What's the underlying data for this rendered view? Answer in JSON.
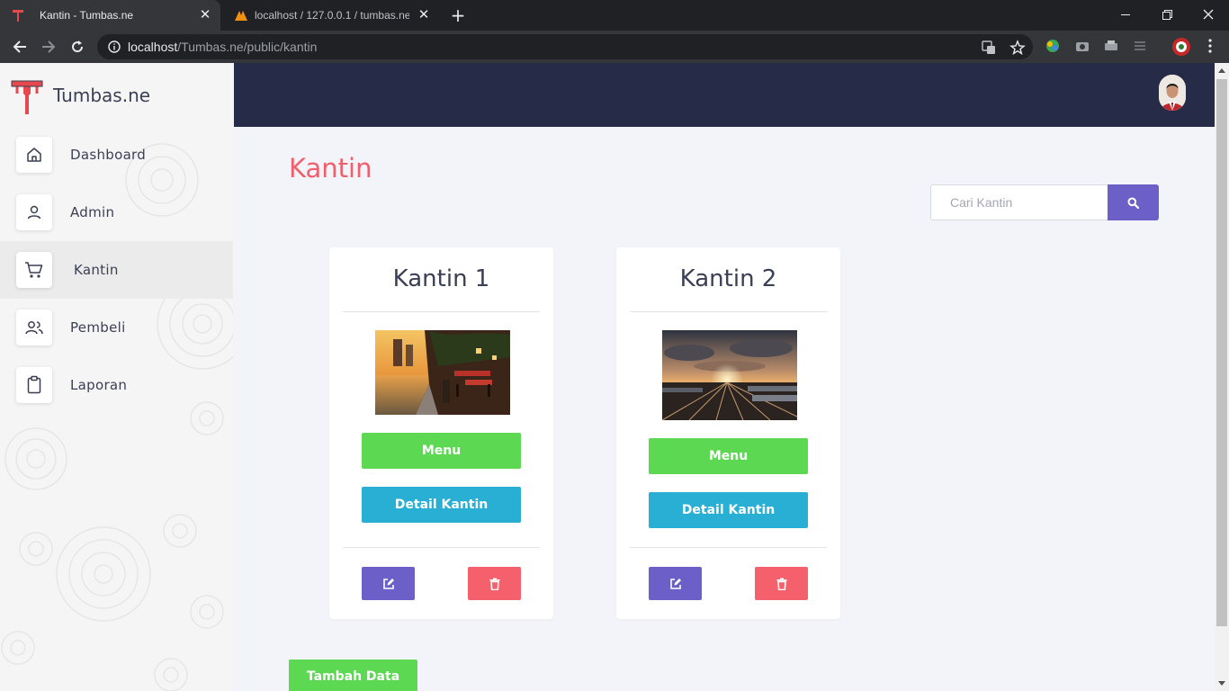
{
  "browser": {
    "tabs": [
      {
        "title": "Kantin - Tumbas.ne",
        "active": true
      },
      {
        "title": "localhost / 127.0.0.1 / tumbas.ne",
        "active": false
      }
    ],
    "url_host": "localhost",
    "url_path": "/Tumbas.ne/public/kantin"
  },
  "app": {
    "brand": "Tumbas.ne",
    "accent": "#f0606c",
    "topbar_color": "#262c48"
  },
  "sidebar": {
    "items": [
      {
        "label": "Dashboard",
        "icon": "home-icon"
      },
      {
        "label": "Admin",
        "icon": "user-icon"
      },
      {
        "label": "Kantin",
        "icon": "cart-icon",
        "active": true
      },
      {
        "label": "Pembeli",
        "icon": "users-icon"
      },
      {
        "label": "Laporan",
        "icon": "clipboard-icon"
      }
    ]
  },
  "main": {
    "title": "Kantin",
    "search": {
      "placeholder": "Cari Kantin"
    },
    "cards": [
      {
        "name": "Kantin 1",
        "menu_label": "Menu",
        "detail_label": "Detail Kantin",
        "image": "waterfront-cafe-sunset-photo"
      },
      {
        "name": "Kantin 2",
        "menu_label": "Menu",
        "detail_label": "Detail Kantin",
        "image": "railway-yard-sunset-photo"
      }
    ],
    "add_label": "Tambah Data"
  }
}
